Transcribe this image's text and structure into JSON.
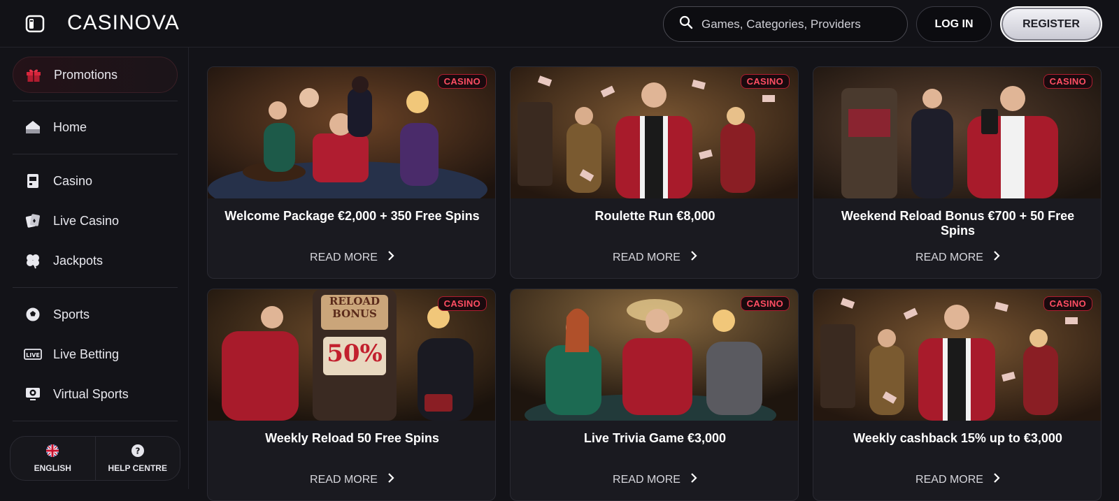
{
  "header": {
    "logo": "CASINOVA",
    "search_placeholder": "Games, Categories, Providers",
    "login_label": "LOG IN",
    "register_label": "REGISTER"
  },
  "sidebar": {
    "promotions": "Promotions",
    "items": [
      {
        "label": "Home",
        "icon": "home-icon"
      },
      {
        "label": "Casino",
        "icon": "slot-machine-icon"
      },
      {
        "label": "Live Casino",
        "icon": "cards-icon"
      },
      {
        "label": "Jackpots",
        "icon": "clover-icon"
      },
      {
        "label": "Sports",
        "icon": "soccer-ball-icon"
      },
      {
        "label": "Live Betting",
        "icon": "live-icon"
      },
      {
        "label": "Virtual Sports",
        "icon": "virtual-sports-icon"
      }
    ],
    "language": "ENGLISH",
    "help": "HELP CENTRE"
  },
  "cards": [
    {
      "badge": "CASINO",
      "title": "Welcome Package €2,000 + 350 Free Spins",
      "more": "READ MORE"
    },
    {
      "badge": "CASINO",
      "title": "Roulette Run €8,000",
      "more": "READ MORE"
    },
    {
      "badge": "CASINO",
      "title": "Weekend Reload Bonus €700 + 50 Free Spins",
      "more": "READ MORE"
    },
    {
      "badge": "CASINO",
      "title": "Weekly Reload 50 Free Spins",
      "more": "READ MORE",
      "image_text": [
        "RELOAD",
        "BONUS",
        "50%"
      ]
    },
    {
      "badge": "CASINO",
      "title": "Live Trivia Game €3,000",
      "more": "READ MORE"
    },
    {
      "badge": "CASINO",
      "title": "Weekly cashback 15% up to €3,000",
      "more": "READ MORE"
    }
  ],
  "colors": {
    "accent_red": "#b01d30",
    "background": "#131318",
    "card_bg": "#1a1a20"
  }
}
